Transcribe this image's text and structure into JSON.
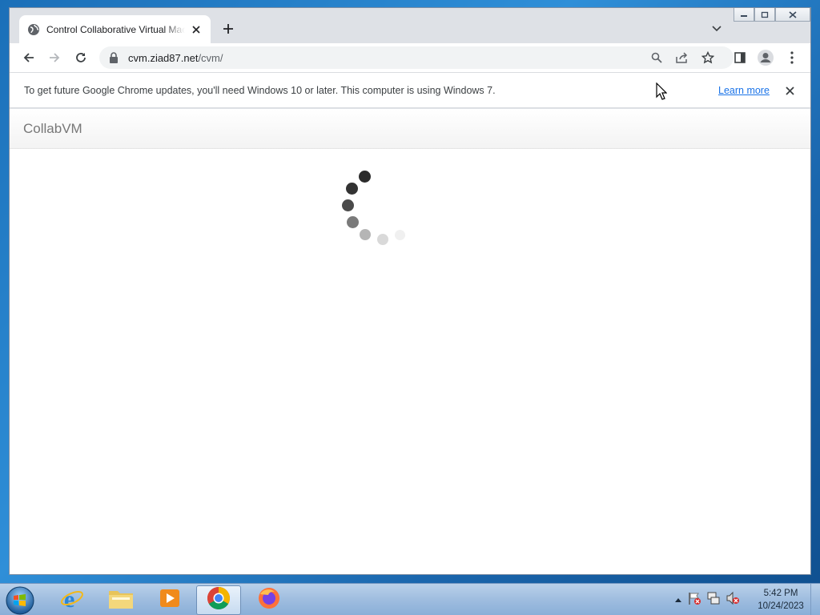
{
  "browser": {
    "tab": {
      "title": "Control Collaborative Virtual Machines",
      "favicon": "globe-icon"
    },
    "address": {
      "host": "cvm.ziad87.net",
      "path": "/cvm/"
    }
  },
  "infobar": {
    "message": "To get future Google Chrome updates, you'll need Windows 10 or later. This computer is using Windows 7.",
    "link": "Learn more"
  },
  "page": {
    "brand": "CollabVM",
    "state": "loading"
  },
  "taskbar": {
    "apps": [
      {
        "name": "Internet Explorer",
        "icon": "ie-icon"
      },
      {
        "name": "Windows Explorer",
        "icon": "folder-icon"
      },
      {
        "name": "Windows Media Player",
        "icon": "media-player-icon"
      },
      {
        "name": "Google Chrome",
        "icon": "chrome-icon",
        "active": true
      },
      {
        "name": "Firefox",
        "icon": "firefox-icon"
      }
    ],
    "clock": {
      "time": "5:42 PM",
      "date": "10/24/2023"
    }
  },
  "colors": {
    "accent": "#1a73e8",
    "taskbar": "#9fbddf",
    "desktop": "#1f78c1"
  }
}
